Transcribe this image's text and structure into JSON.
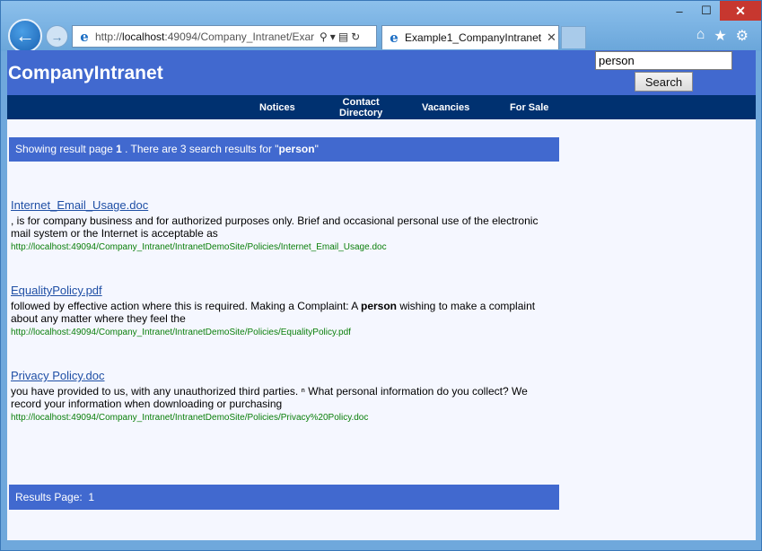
{
  "browser": {
    "window_controls": {
      "minimize": "–",
      "maximize": "☐",
      "close": "✕"
    },
    "address": {
      "prefix": "http://",
      "host": "localhost",
      "rest": ":49094/Company_Intranet/Exar"
    },
    "tab": {
      "title": "Example1_CompanyIntranet",
      "close": "✕"
    },
    "icons": [
      "back-arrow-icon",
      "forward-arrow-icon",
      "ie-logo-icon",
      "search-icon",
      "refresh-icon",
      "home-icon",
      "star-icon",
      "gear-icon"
    ]
  },
  "site": {
    "title": "CompanyIntranet",
    "search": {
      "value": "person",
      "button_label": "Search"
    },
    "nav": [
      {
        "label": "Notices"
      },
      {
        "label": "Contact",
        "label2": "Directory"
      },
      {
        "label": "Vacancies"
      },
      {
        "label": "For Sale"
      }
    ]
  },
  "summary": {
    "prefix": "Showing result page ",
    "page": "1",
    "middle": " . There are 3 search results for \"",
    "term": "person",
    "suffix": "\""
  },
  "results": [
    {
      "title": "Internet_Email_Usage.doc",
      "snippet_before": ", is for company business and for authorized purposes only. Brief and occasional personal use of the electronic mail system or the Internet is acceptable as",
      "snippet_bold": "",
      "snippet_after": "",
      "url": "http://localhost:49094/Company_Intranet/IntranetDemoSite/Policies/Internet_Email_Usage.doc"
    },
    {
      "title": "EqualityPolicy.pdf",
      "snippet_before": "followed by effective action where this is required. Making a Complaint: A ",
      "snippet_bold": "person",
      "snippet_after": " wishing to make a complaint about any matter where they feel the",
      "url": "http://localhost:49094/Company_Intranet/IntranetDemoSite/Policies/EqualityPolicy.pdf"
    },
    {
      "title": "Privacy Policy.doc",
      "snippet_before": "you have provided to us, with any unauthorized third parties. ⁿ What personal information do you collect? We record your information when downloading or purchasing",
      "snippet_bold": "",
      "snippet_after": "",
      "url": "http://localhost:49094/Company_Intranet/IntranetDemoSite/Policies/Privacy%20Policy.doc"
    }
  ],
  "footer": {
    "label": "Results Page:",
    "page": "1"
  },
  "colors": {
    "header": "#4169cf",
    "navbar": "#003170",
    "link": "#1f4fa5",
    "url_green": "#0a7f0a",
    "page_bg": "#f5f7ff"
  }
}
